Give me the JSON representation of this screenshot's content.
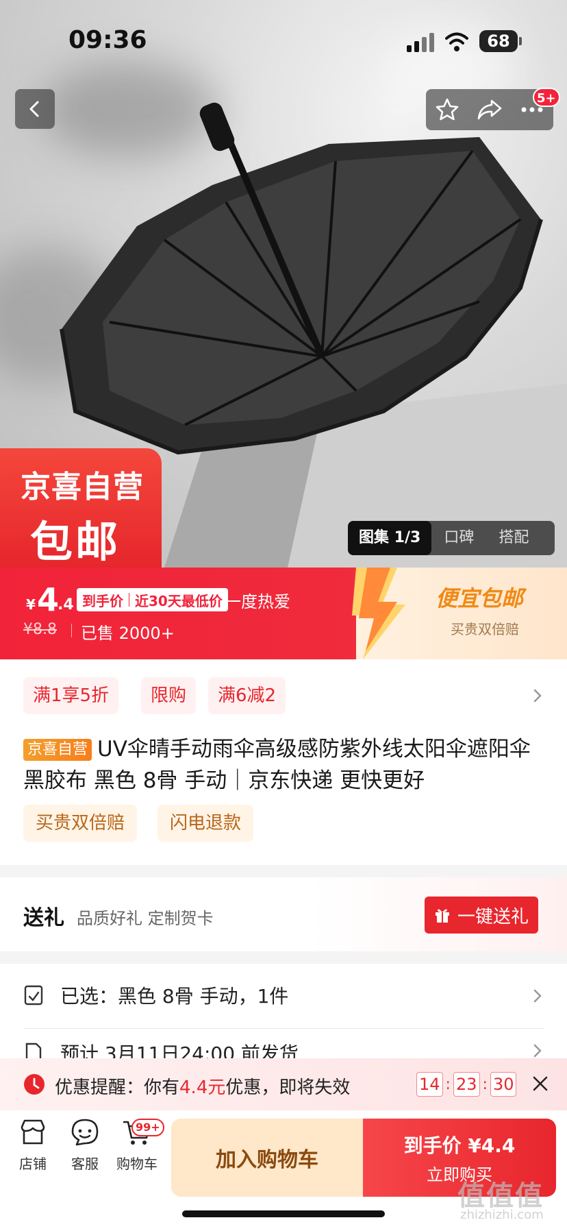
{
  "status_bar": {
    "time": "09:36",
    "battery": "68"
  },
  "top_actions": {
    "message_badge": "5+"
  },
  "hero": {
    "promo_line1": "京喜自营",
    "promo_line2": "包邮",
    "gallery_tabs": [
      {
        "label": "图集 1/3",
        "active": true
      },
      {
        "label": "口碑",
        "active": false
      },
      {
        "label": "搭配",
        "active": false
      }
    ]
  },
  "price_banner": {
    "currency": "¥",
    "price_int": "4",
    "price_dec": ".4",
    "tag_final": "到手价",
    "tag_lowest": "近30天最低价",
    "slogan": "一度热爱",
    "old_price": "¥8.8",
    "sold": "已售 2000+",
    "promo_title": "便宜包邮",
    "promo_sub": "买贵双倍赔"
  },
  "coupons": [
    "满1享5折",
    "限购",
    "满6减2"
  ],
  "product": {
    "badge": "京喜自营",
    "title": "UV伞晴手动雨伞高级感防紫外线太阳伞遮阳伞黑胶布 黑色 8骨 手动｜京东快递 更快更好"
  },
  "services": [
    "买贵双倍赔",
    "闪电退款"
  ],
  "gift": {
    "title": "送礼",
    "subtitle": "品质好礼 定制贺卡",
    "button": "一键送礼"
  },
  "selection": {
    "selected": "已选：黑色 8骨 手动，1件",
    "delivery": "预计 3月11日24:00 前发货"
  },
  "reminder": {
    "prefix": "优惠提醒：你有",
    "amount": "4.4元",
    "suffix": "优惠，即将失效",
    "hours": "14",
    "minutes": "23",
    "seconds": "30"
  },
  "bottom_bar": {
    "shop": "店铺",
    "service": "客服",
    "cart": "购物车",
    "cart_badge": "99+",
    "add_to_cart": "加入购物车",
    "buy_line1": "到手价 ¥4.4",
    "buy_line2": "立即购买"
  },
  "watermark": {
    "text": "值值值",
    "sub": "zhizhizhi.com"
  },
  "colors": {
    "brand_red": "#e8262d",
    "promo_orange": "#f08a16",
    "service_brown": "#b8661a"
  }
}
